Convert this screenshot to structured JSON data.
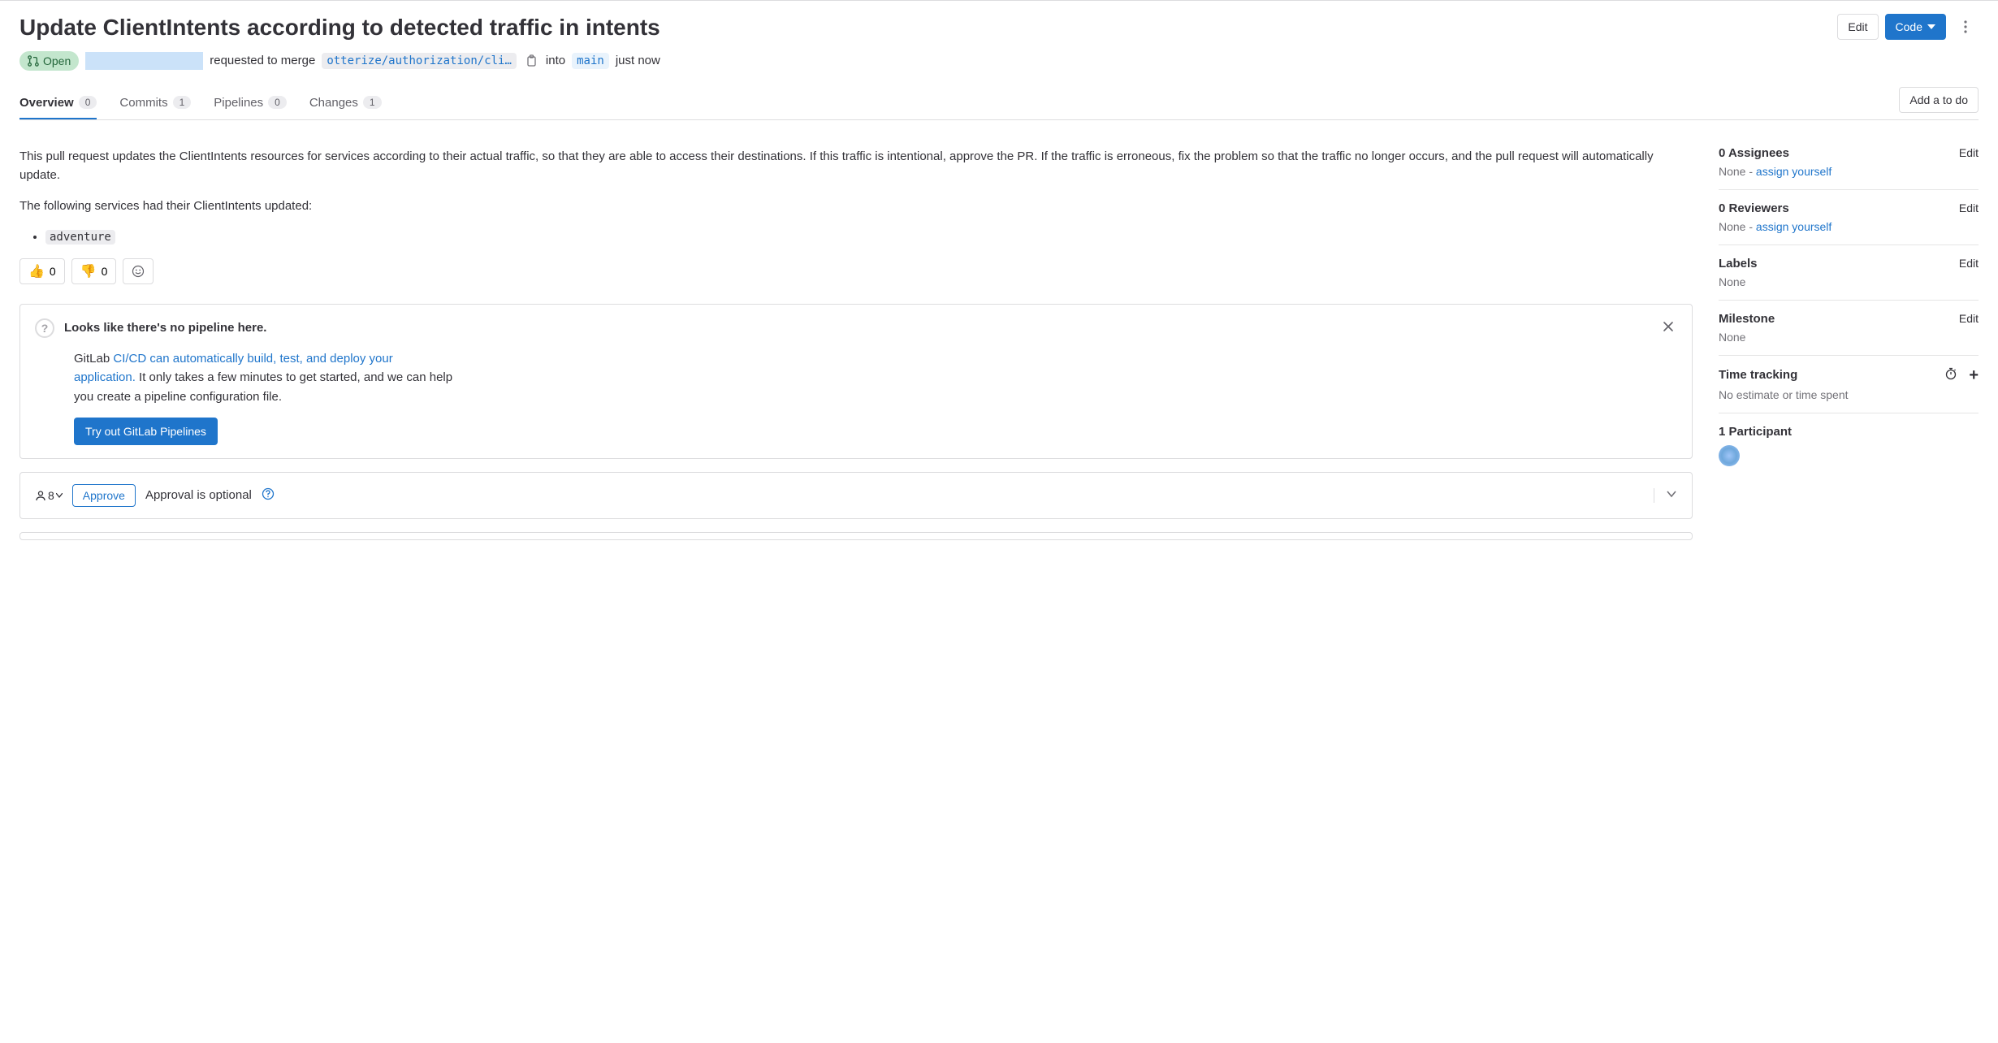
{
  "header": {
    "title": "Update ClientIntents according to detected traffic in intents",
    "edit_label": "Edit",
    "code_label": "Code"
  },
  "status": {
    "state": "Open",
    "requested_text": "requested to merge",
    "source_branch": "otterize/authorization/cli…",
    "into_text": "into",
    "target_branch": "main",
    "when": "just now"
  },
  "tabs": {
    "overview": {
      "label": "Overview",
      "count": "0"
    },
    "commits": {
      "label": "Commits",
      "count": "1"
    },
    "pipelines": {
      "label": "Pipelines",
      "count": "0"
    },
    "changes": {
      "label": "Changes",
      "count": "1"
    },
    "add_todo": "Add a to do"
  },
  "description": {
    "p1": "This pull request updates the ClientIntents resources for services according to their actual traffic, so that they are able to access their destinations. If this traffic is intentional, approve the PR. If the traffic is erroneous, fix the problem so that the traffic no longer occurs, and the pull request will automatically update.",
    "p2": "The following services had their ClientIntents updated:",
    "items": [
      "adventure"
    ]
  },
  "reactions": {
    "thumbs_up": "0",
    "thumbs_down": "0"
  },
  "pipeline_card": {
    "title": "Looks like there's no pipeline here.",
    "body_prefix": "GitLab ",
    "body_link": "CI/CD can automatically build, test, and deploy your application.",
    "body_suffix": " It only takes a few minutes to get started, and we can help you create a pipeline configuration file.",
    "cta": "Try out GitLab Pipelines"
  },
  "approval": {
    "count_label": "8",
    "approve_label": "Approve",
    "optional_text": "Approval is optional"
  },
  "sidebar": {
    "assignees": {
      "title": "0 Assignees",
      "sub_prefix": "None - ",
      "sub_link": "assign yourself",
      "edit": "Edit"
    },
    "reviewers": {
      "title": "0 Reviewers",
      "sub_prefix": "None - ",
      "sub_link": "assign yourself",
      "edit": "Edit"
    },
    "labels": {
      "title": "Labels",
      "sub": "None",
      "edit": "Edit"
    },
    "milestone": {
      "title": "Milestone",
      "sub": "None",
      "edit": "Edit"
    },
    "time": {
      "title": "Time tracking",
      "sub": "No estimate or time spent"
    },
    "participants": {
      "title": "1 Participant"
    }
  }
}
